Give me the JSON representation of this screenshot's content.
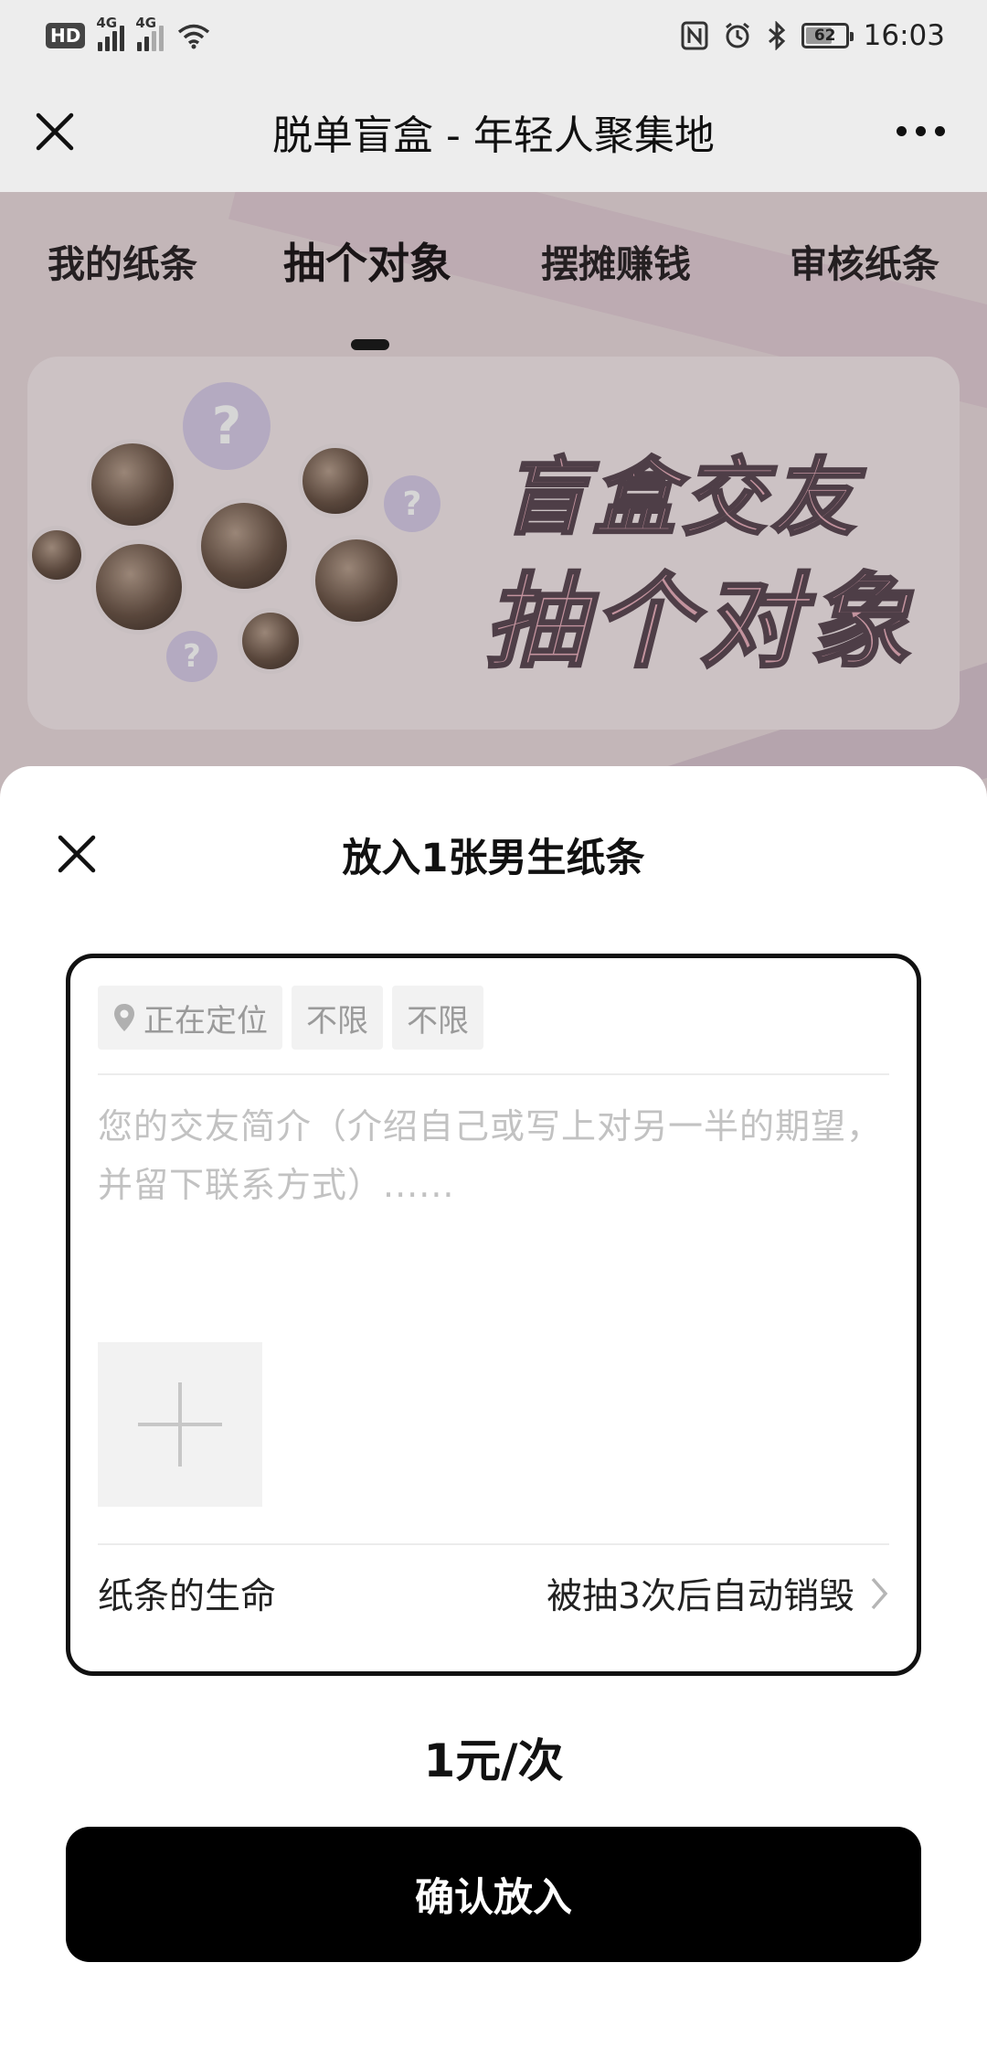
{
  "status_bar": {
    "hd": "HD",
    "net1": "4G",
    "net2": "4G",
    "battery": "62",
    "battery_level": 0.62,
    "time": "16:03"
  },
  "nav": {
    "title": "脱单盲盒 - 年轻人聚集地"
  },
  "tabs": [
    {
      "label": "我的纸条",
      "active": false
    },
    {
      "label": "抽个对象",
      "active": true
    },
    {
      "label": "摆摊赚钱",
      "active": false
    },
    {
      "label": "审核纸条",
      "active": false
    }
  ],
  "banner": {
    "line1": "盲盒交友",
    "line2": "抽个对象",
    "question_mark": "?"
  },
  "sheet": {
    "title": "放入1张男生纸条",
    "chips": [
      "正在定位",
      "不限",
      "不限"
    ],
    "intro_placeholder": "您的交友简介（介绍自己或写上对另一半的期望，并留下联系方式）......",
    "life_label": "纸条的生命",
    "life_value": "被抽3次后自动销毁",
    "price": "1元/次",
    "confirm_label": "确认放入"
  },
  "colors": {
    "accent": "#000000",
    "overlay_bg": "#e9d9dc",
    "placeholder": "#c2c2c2"
  },
  "icons": [
    "close-icon",
    "more-icon",
    "location-pin-icon",
    "plus-icon",
    "chevron-right-icon",
    "wifi-icon",
    "nfc-icon",
    "alarm-icon",
    "bluetooth-icon"
  ]
}
